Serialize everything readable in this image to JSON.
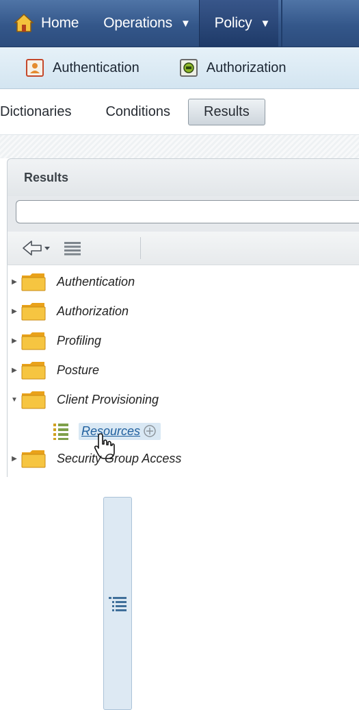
{
  "topnav": {
    "home_label": "Home",
    "operations_label": "Operations",
    "policy_label": "Policy",
    "caret": "▼"
  },
  "subnav": {
    "authentication_label": "Authentication",
    "authorization_label": "Authorization"
  },
  "tabs": {
    "dictionaries": "Dictionaries",
    "conditions": "Conditions",
    "results": "Results"
  },
  "panel": {
    "title": "Results",
    "search": {
      "value": "",
      "placeholder": ""
    }
  },
  "tree": {
    "items": [
      {
        "label": "Authentication",
        "expanded": false
      },
      {
        "label": "Authorization",
        "expanded": false
      },
      {
        "label": "Profiling",
        "expanded": false
      },
      {
        "label": "Posture",
        "expanded": false
      },
      {
        "label": "Client Provisioning",
        "expanded": true
      },
      {
        "label": "Security Group Access",
        "expanded": false
      }
    ],
    "child": {
      "label": "Resources"
    }
  },
  "colors": {
    "nav_bg": "#34578a",
    "subnav_bg": "#d3e5f1",
    "folder": "#f1b92e",
    "link": "#1f5f9e"
  }
}
